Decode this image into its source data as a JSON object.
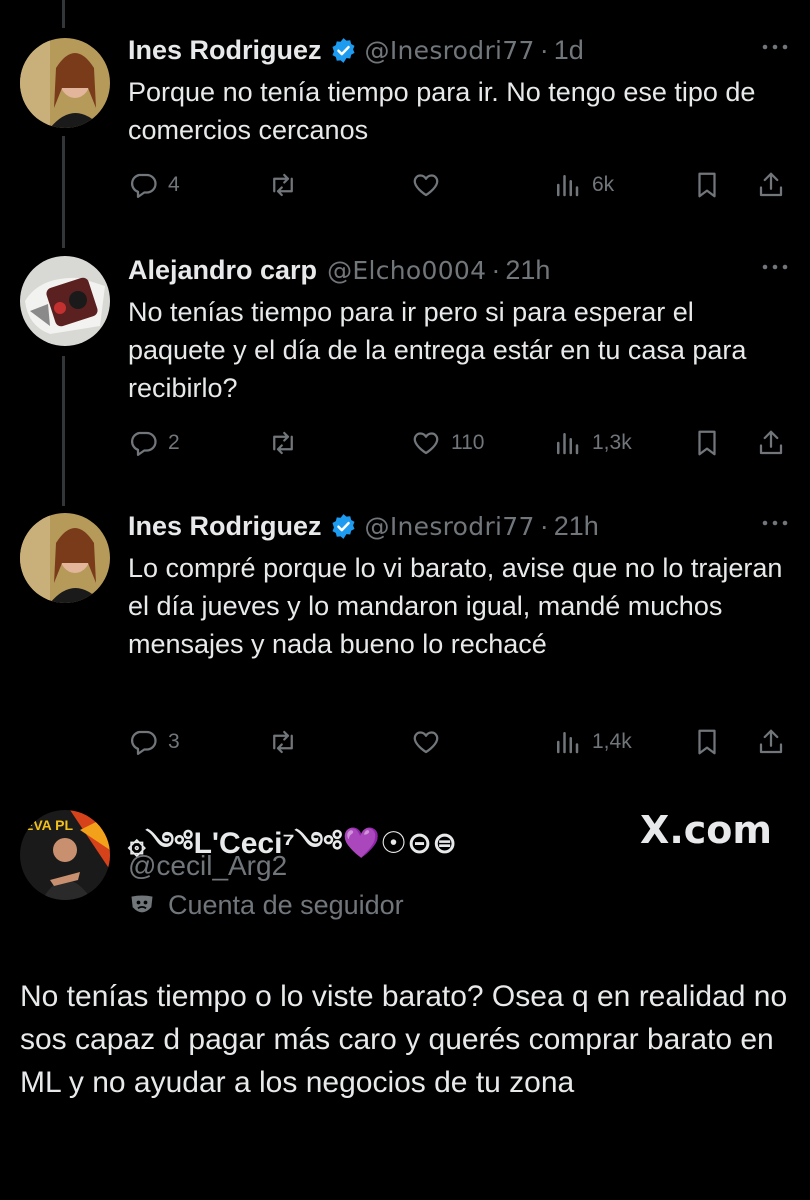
{
  "tweets": [
    {
      "name": "Ines Rodriguez",
      "handle": "@Inesrodri77",
      "sep": "·",
      "time": "1d",
      "text": "Porque no tenía tiempo para ir. No tengo ese tipo de comercios cercanos",
      "replies": "4",
      "retweets": "",
      "likes": "",
      "views": "6k"
    },
    {
      "name": "Alejandro carp",
      "handle": "@Elcho0004",
      "sep": "·",
      "time": "21h",
      "text": "No tenías tiempo para ir pero si para esperar el paquete y el día de la entrega estár en tu casa para recibirlo?",
      "replies": "2",
      "retweets": "",
      "likes": "110",
      "views": "1,3k"
    },
    {
      "name": "Ines Rodriguez",
      "handle": "@Inesrodri77",
      "sep": "·",
      "time": "21h",
      "text": "Lo compré porque lo vi barato, avise que no lo trajeran el día jueves y lo mandaron igual, mandé muchos mensajes y nada bueno lo rechacé",
      "replies": "3",
      "retweets": "",
      "likes": "",
      "views": "1,4k"
    }
  ],
  "quote": {
    "name": "۞༺L'Ceci⁷༺💜☉⊝⊜",
    "handle": "@cecil_Arg2",
    "follower_label": "Cuenta de seguidor",
    "brand": "X.com",
    "avatar_text": "EVA PL",
    "reply_text": "No tenías tiempo o lo viste barato? Osea q en realidad no sos capaz d pagar más caro y querés comprar barato en ML y no ayudar a los negocios de tu zona"
  },
  "icons": {
    "reply": "reply-icon",
    "retweet": "retweet-icon",
    "like": "heart-icon",
    "views": "views-icon",
    "bookmark": "bookmark-icon",
    "share": "share-icon",
    "verified": "verified-badge-icon",
    "more": "more-icon",
    "follower": "theater-mask-icon"
  },
  "colors": {
    "background": "#000000",
    "text": "#e7e9ea",
    "muted": "#71767b",
    "verified": "#1d9bf0",
    "thread_line": "#333639"
  }
}
